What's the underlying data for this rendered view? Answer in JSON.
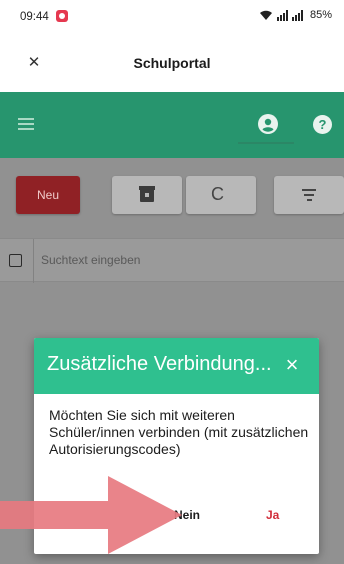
{
  "status_bar": {
    "time": "09:44",
    "battery": "85%",
    "notification_color": "#e53950"
  },
  "title_bar": {
    "close_icon": "close-icon",
    "title": "Schulportal"
  },
  "app_bar": {
    "background": "#27956e",
    "menu_icon": "menu-icon",
    "account_icon": "account-circle-icon",
    "help_label": "?"
  },
  "toolbar": {
    "new_label": "Neu",
    "new_color": "#902125",
    "archive_icon": "archive-icon",
    "refresh_icon": "refresh-icon",
    "refresh_glyph": "C",
    "filter_icon": "filter-icon"
  },
  "search": {
    "placeholder": "Suchtext eingeben"
  },
  "dialog": {
    "title": "Zusätzliche Verbindung...",
    "close_label": "×",
    "body": "Möchten Sie sich mit weiteren Schüler/innen verbinden (mit zusätzlichen Autorisierungscodes)",
    "no_label": "Nein",
    "yes_label": "Ja",
    "header_color": "#2fc08f",
    "yes_color": "#d12d3a"
  },
  "annotation": {
    "arrow_color": "#e77a80"
  }
}
